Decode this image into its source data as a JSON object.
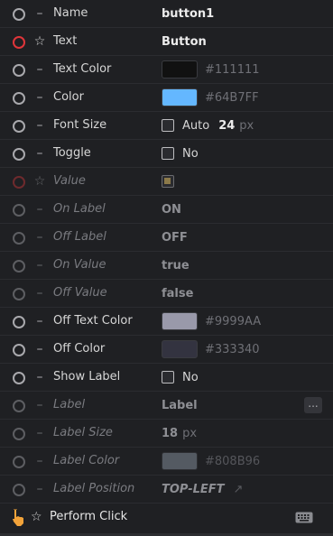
{
  "rows": [
    {
      "name": "Name",
      "mark": "–",
      "radio": "normal",
      "disabled": false,
      "value_type": "text",
      "value": "button1"
    },
    {
      "name": "Text",
      "mark": "☆",
      "radio": "red",
      "disabled": false,
      "value_type": "text",
      "value": "Button"
    },
    {
      "name": "Text Color",
      "mark": "–",
      "radio": "normal",
      "disabled": false,
      "value_type": "color",
      "color": "#111111",
      "hex": "#111111"
    },
    {
      "name": "Color",
      "mark": "–",
      "radio": "normal",
      "disabled": false,
      "value_type": "color",
      "color": "#64B7FF",
      "hex": "#64B7FF"
    },
    {
      "name": "Font Size",
      "mark": "–",
      "radio": "normal",
      "disabled": false,
      "value_type": "fontsize",
      "check_label": "Auto",
      "size": "24",
      "unit": "px"
    },
    {
      "name": "Toggle",
      "mark": "–",
      "radio": "normal",
      "disabled": false,
      "value_type": "check",
      "check_label": "No"
    },
    {
      "name": "Value",
      "mark": "☆",
      "radio": "red",
      "disabled": true,
      "value_type": "checked_box"
    },
    {
      "name": "On Label",
      "mark": "–",
      "radio": "normal",
      "disabled": true,
      "value_type": "text",
      "value": "ON"
    },
    {
      "name": "Off Label",
      "mark": "–",
      "radio": "normal",
      "disabled": true,
      "value_type": "text",
      "value": "OFF"
    },
    {
      "name": "On Value",
      "mark": "–",
      "radio": "normal",
      "disabled": true,
      "value_type": "text",
      "value": "true"
    },
    {
      "name": "Off Value",
      "mark": "–",
      "radio": "normal",
      "disabled": true,
      "value_type": "text",
      "value": "false"
    },
    {
      "name": "Off Text Color",
      "mark": "–",
      "radio": "normal",
      "disabled": false,
      "value_type": "color",
      "color": "#9999AA",
      "hex": "#9999AA"
    },
    {
      "name": "Off Color",
      "mark": "–",
      "radio": "normal",
      "disabled": false,
      "value_type": "color",
      "color": "#333340",
      "hex": "#333340"
    },
    {
      "name": "Show Label",
      "mark": "–",
      "radio": "normal",
      "disabled": false,
      "value_type": "check",
      "check_label": "No"
    },
    {
      "name": "Label",
      "mark": "–",
      "radio": "normal",
      "disabled": true,
      "value_type": "text_dots",
      "value": "Label",
      "dots": "..."
    },
    {
      "name": "Label Size",
      "mark": "–",
      "radio": "normal",
      "disabled": true,
      "value_type": "size",
      "size": "18",
      "unit": "px"
    },
    {
      "name": "Label Color",
      "mark": "–",
      "radio": "normal",
      "disabled": true,
      "value_type": "color",
      "color": "#808B96",
      "hex": "#808B96"
    },
    {
      "name": "Label Position",
      "mark": "–",
      "radio": "normal",
      "disabled": true,
      "value_type": "position",
      "value": "TOP-LEFT",
      "arrow": "↗"
    }
  ],
  "perform": {
    "label": "Perform Click",
    "mark": "☆",
    "hand_icon": "pointer-hand-icon",
    "kbd_icon": "keyboard-icon"
  },
  "colors": {
    "value_checkbox": "#8c7a4a",
    "accent_red": "#e0353a"
  }
}
